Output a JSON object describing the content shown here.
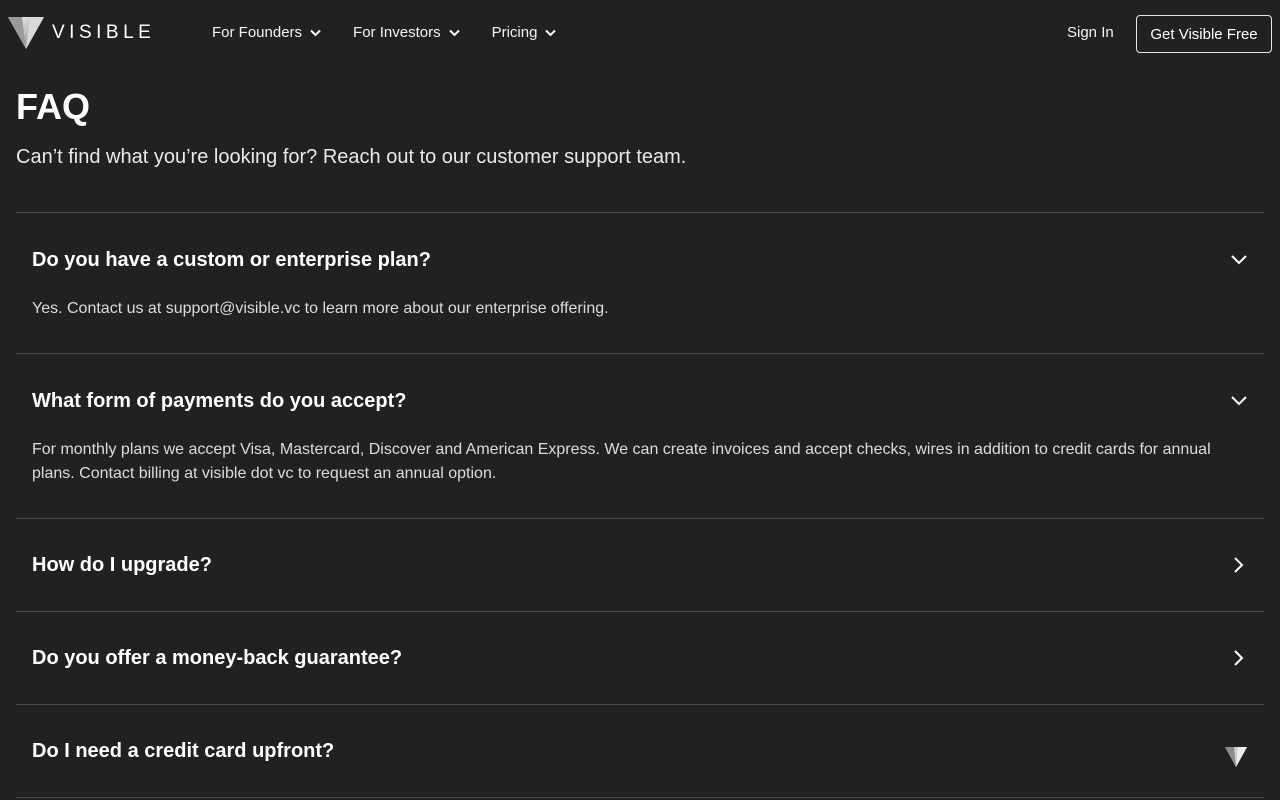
{
  "header": {
    "brand": "VISIBLE",
    "nav": [
      {
        "label": "For Founders",
        "icon": "chevron-down-icon"
      },
      {
        "label": "For Investors",
        "icon": "chevron-down-icon"
      },
      {
        "label": "Pricing",
        "icon": "chevron-down-icon"
      }
    ],
    "sign_in": "Sign In",
    "cta": "Get Visible Free"
  },
  "main": {
    "title": "FAQ",
    "subtitle": "Can’t find what you’re looking for? Reach out to our customer support team."
  },
  "faq": [
    {
      "question": "Do you have a custom or enterprise plan?",
      "answer": "Yes. Contact us at support@visible.vc to learn more about our enterprise offering.",
      "expanded": true,
      "icon": "chevron-down-icon"
    },
    {
      "question": "What form of payments do you accept?",
      "answer": "For monthly plans we accept Visa, Mastercard, Discover and American Express. We can create invoices and accept checks, wires in addition to credit cards for annual plans. Contact billing at visible dot vc to request an annual option.",
      "expanded": true,
      "icon": "chevron-down-icon"
    },
    {
      "question": "How do I upgrade?",
      "expanded": false,
      "icon": "chevron-right-icon"
    },
    {
      "question": "Do you offer a money-back guarantee?",
      "expanded": false,
      "icon": "chevron-right-icon"
    },
    {
      "question": "Do I need a credit card upfront?",
      "expanded": false,
      "icon": "visible-logo-icon"
    }
  ],
  "colors": {
    "background": "#212121",
    "divider": "#4a4a4a",
    "text": "#ffffff"
  }
}
